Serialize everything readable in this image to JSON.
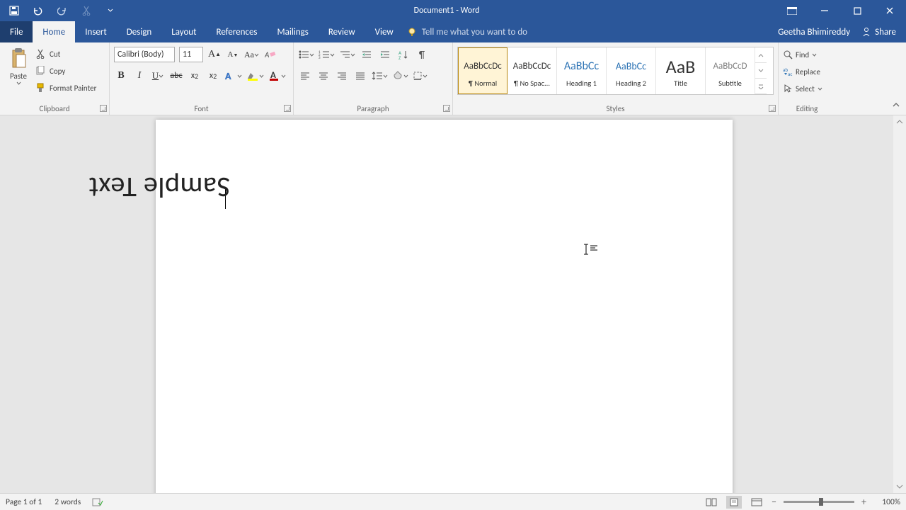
{
  "titlebar": {
    "title": "Document1 - Word"
  },
  "tabs": {
    "file": "File",
    "home": "Home",
    "insert": "Insert",
    "design": "Design",
    "layout": "Layout",
    "references": "References",
    "mailings": "Mailings",
    "review": "Review",
    "view": "View",
    "tellme": "Tell me what you want to do"
  },
  "user": {
    "name": "Geetha Bhimireddy",
    "share": "Share"
  },
  "clipboard": {
    "paste": "Paste",
    "cut": "Cut",
    "copy": "Copy",
    "format_painter": "Format Painter",
    "label": "Clipboard"
  },
  "font": {
    "name": "Calibri (Body)",
    "size": "11",
    "label": "Font"
  },
  "paragraph": {
    "label": "Paragraph"
  },
  "styles": {
    "label": "Styles",
    "items": [
      {
        "preview": "AaBbCcDc",
        "name": "¶ Normal",
        "color": "#000",
        "size": "13px"
      },
      {
        "preview": "AaBbCcDc",
        "name": "¶ No Spac...",
        "color": "#000",
        "size": "13px"
      },
      {
        "preview": "AaBbCc",
        "name": "Heading 1",
        "color": "#2e74b5",
        "size": "16px"
      },
      {
        "preview": "AaBbCc",
        "name": "Heading 2",
        "color": "#2e74b5",
        "size": "14px"
      },
      {
        "preview": "AaB",
        "name": "Title",
        "color": "#000",
        "size": "26px"
      },
      {
        "preview": "AaBbCcD",
        "name": "Subtitle",
        "color": "#7f7f7f",
        "size": "13px"
      }
    ]
  },
  "editing": {
    "find": "Find",
    "replace": "Replace",
    "select": "Select",
    "label": "Editing"
  },
  "document": {
    "sample_text": "Sample Text"
  },
  "status": {
    "page": "Page 1 of 1",
    "words": "2 words",
    "zoom": "100%"
  }
}
